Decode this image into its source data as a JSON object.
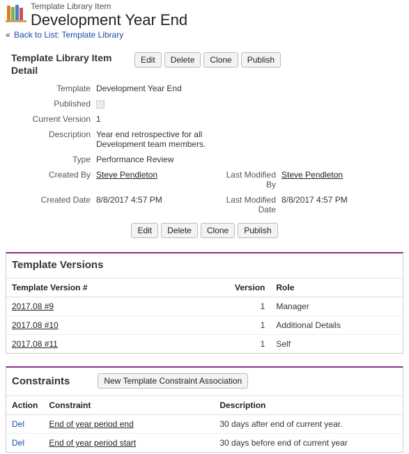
{
  "header": {
    "page_type": "Template Library Item",
    "title": "Development Year End"
  },
  "back_link": {
    "caret": "«",
    "text": "Back to List: Template Library"
  },
  "detail": {
    "section_title": "Template Library Item Detail",
    "buttons": {
      "edit": "Edit",
      "delete": "Delete",
      "clone": "Clone",
      "publish": "Publish"
    },
    "labels": {
      "template": "Template",
      "published": "Published",
      "current_version": "Current Version",
      "description": "Description",
      "type": "Type",
      "created_by": "Created By",
      "created_date": "Created Date",
      "last_modified_by": "Last Modified By",
      "last_modified_date": "Last Modified Date"
    },
    "values": {
      "template": "Development Year End",
      "current_version": "1",
      "description": "Year end retrospective for all Development team members.",
      "type": "Performance Review",
      "created_by": "Steve Pendleton",
      "created_date": "8/8/2017 4:57 PM",
      "last_modified_by": "Steve Pendleton",
      "last_modified_date": "8/8/2017 4:57 PM"
    }
  },
  "versions": {
    "title": "Template Versions",
    "cols": {
      "num": "Template Version #",
      "version": "Version",
      "role": "Role"
    },
    "rows": [
      {
        "num": "2017.08 #9",
        "version": "1",
        "role": "Manager"
      },
      {
        "num": "2017.08 #10",
        "version": "1",
        "role": "Additional Details"
      },
      {
        "num": "2017.08 #11",
        "version": "1",
        "role": "Self"
      }
    ]
  },
  "constraints": {
    "title": "Constraints",
    "new_button": "New Template Constraint Association",
    "cols": {
      "action": "Action",
      "constraint": "Constraint",
      "description": "Description"
    },
    "del_label": "Del",
    "rows": [
      {
        "constraint": "End of year period end",
        "description": "30 days after end of current year."
      },
      {
        "constraint": "End of year period start",
        "description": "30 days before end of current year"
      }
    ]
  }
}
